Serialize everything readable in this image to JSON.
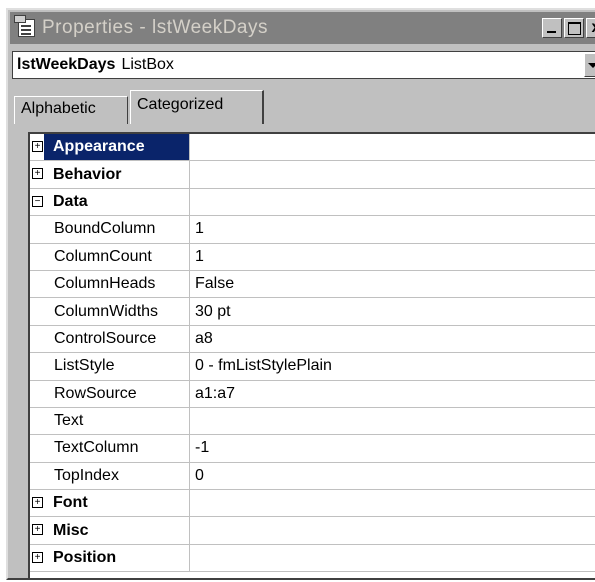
{
  "window": {
    "title": "Properties - lstWeekDays",
    "min_label": "_",
    "max_label": "",
    "close_label": "x"
  },
  "object_selector": {
    "name": "lstWeekDays",
    "type": "ListBox"
  },
  "tabs": [
    {
      "label": "Alphabetic",
      "active": false
    },
    {
      "label": "Categorized",
      "active": true
    }
  ],
  "grid": {
    "rows": [
      {
        "kind": "category",
        "expander": "+",
        "name": "Appearance",
        "value": "",
        "selected": true
      },
      {
        "kind": "category",
        "expander": "+",
        "name": "Behavior",
        "value": ""
      },
      {
        "kind": "category",
        "expander": "−",
        "name": "Data",
        "value": ""
      },
      {
        "kind": "property",
        "name": "BoundColumn",
        "value": "1"
      },
      {
        "kind": "property",
        "name": "ColumnCount",
        "value": "1"
      },
      {
        "kind": "property",
        "name": "ColumnHeads",
        "value": "False"
      },
      {
        "kind": "property",
        "name": "ColumnWidths",
        "value": "30 pt"
      },
      {
        "kind": "property",
        "name": "ControlSource",
        "value": "a8"
      },
      {
        "kind": "property",
        "name": "ListStyle",
        "value": "0 - fmListStylePlain"
      },
      {
        "kind": "property",
        "name": "RowSource",
        "value": "a1:a7"
      },
      {
        "kind": "property",
        "name": "Text",
        "value": ""
      },
      {
        "kind": "property",
        "name": "TextColumn",
        "value": "-1"
      },
      {
        "kind": "property",
        "name": "TopIndex",
        "value": "0"
      },
      {
        "kind": "category",
        "expander": "+",
        "name": "Font",
        "value": ""
      },
      {
        "kind": "category",
        "expander": "+",
        "name": "Misc",
        "value": ""
      },
      {
        "kind": "category",
        "expander": "+",
        "name": "Position",
        "value": ""
      }
    ]
  },
  "colors": {
    "selection": "#0a246a",
    "title_inactive": "#808080",
    "face": "#c0c0c0"
  }
}
